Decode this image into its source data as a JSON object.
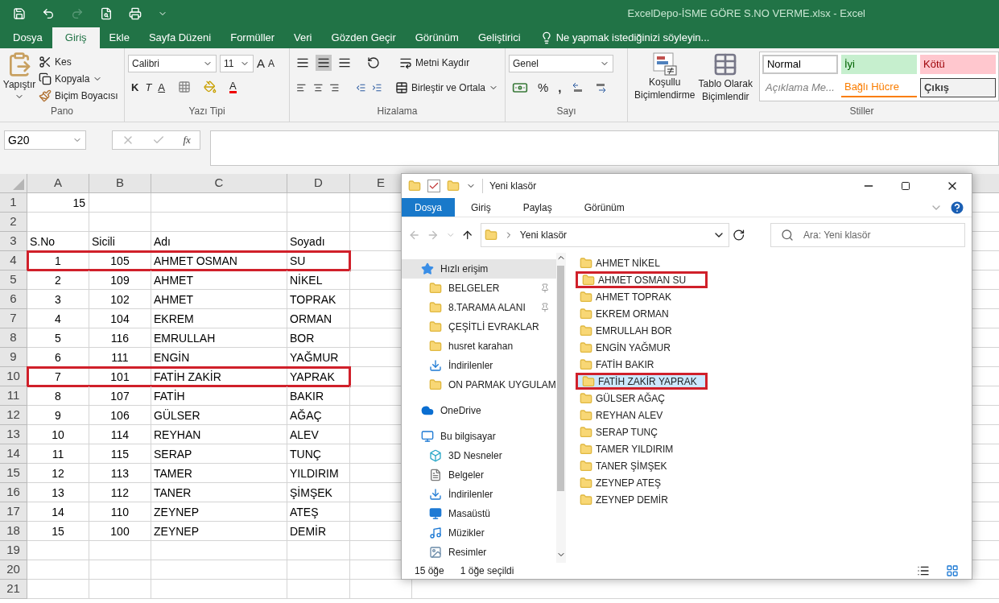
{
  "excel": {
    "title": "ExcelDepo-İSME GÖRE S.NO VERME.xlsx - Excel",
    "tabs": [
      {
        "label": "Dosya",
        "selected": false
      },
      {
        "label": "Giriş",
        "selected": true
      },
      {
        "label": "Ekle",
        "selected": false
      },
      {
        "label": "Sayfa Düzeni",
        "selected": false
      },
      {
        "label": "Formüller",
        "selected": false
      },
      {
        "label": "Veri",
        "selected": false
      },
      {
        "label": "Gözden Geçir",
        "selected": false
      },
      {
        "label": "Görünüm",
        "selected": false
      },
      {
        "label": "Geliştirici",
        "selected": false
      }
    ],
    "tell_me": "Ne yapmak istediğinizi söyleyin...",
    "ribbon": {
      "clipboard": {
        "label": "Pano",
        "paste": "Yapıştır",
        "cut": "Kes",
        "copy": "Kopyala",
        "painter": "Biçim Boyacısı"
      },
      "font": {
        "label": "Yazı Tipi",
        "name": "Calibri",
        "size": "11",
        "grow": "A",
        "shrink": "A",
        "bold": "K",
        "italic": "T",
        "underline": "A",
        "text_color_button": "A"
      },
      "alignment": {
        "label": "Hizalama",
        "wrap": "Metni Kaydır",
        "merge": "Birleştir ve Ortala"
      },
      "number": {
        "label": "Sayı",
        "format": "Genel",
        "percent": "%",
        "comma": ","
      },
      "conditional": "Koşullu Biçimlendirme",
      "table": "Tablo Olarak Biçimlendir",
      "styles": {
        "label": "Stiller",
        "cells": [
          {
            "label": "Normal",
            "kind": "normal"
          },
          {
            "label": "İyi",
            "kind": "good"
          },
          {
            "label": "Kötü",
            "kind": "bad"
          },
          {
            "label": "Açıklama Me...",
            "kind": "note"
          },
          {
            "label": "Bağlı Hücre",
            "kind": "linked"
          },
          {
            "label": "Çıkış",
            "kind": "output"
          }
        ]
      }
    },
    "name_box": "G20",
    "function_label": "fx",
    "columns": [
      "A",
      "B",
      "C",
      "D",
      "E"
    ],
    "rows": [
      {
        "number": "1",
        "cells": [
          "15",
          "",
          "",
          ""
        ],
        "highlighted": false,
        "kind": "top"
      },
      {
        "number": "2",
        "cells": [
          "",
          "",
          "",
          ""
        ],
        "highlighted": false,
        "kind": "data"
      },
      {
        "number": "3",
        "cells": [
          "S.No",
          "Sicili",
          "Adı",
          "Soyadı"
        ],
        "highlighted": false,
        "kind": "header"
      },
      {
        "number": "4",
        "cells": [
          "1",
          "105",
          "AHMET OSMAN",
          "SU"
        ],
        "highlighted": true,
        "kind": "data"
      },
      {
        "number": "5",
        "cells": [
          "2",
          "109",
          "AHMET",
          "NİKEL"
        ],
        "highlighted": false,
        "kind": "data"
      },
      {
        "number": "6",
        "cells": [
          "3",
          "102",
          "AHMET",
          "TOPRAK"
        ],
        "highlighted": false,
        "kind": "data"
      },
      {
        "number": "7",
        "cells": [
          "4",
          "104",
          "EKREM",
          "ORMAN"
        ],
        "highlighted": false,
        "kind": "data"
      },
      {
        "number": "8",
        "cells": [
          "5",
          "116",
          "EMRULLAH",
          "BOR"
        ],
        "highlighted": false,
        "kind": "data"
      },
      {
        "number": "9",
        "cells": [
          "6",
          "111",
          "ENGİN",
          "YAĞMUR"
        ],
        "highlighted": false,
        "kind": "data"
      },
      {
        "number": "10",
        "cells": [
          "7",
          "101",
          "FATİH ZAKİR",
          "YAPRAK"
        ],
        "highlighted": true,
        "kind": "data"
      },
      {
        "number": "11",
        "cells": [
          "8",
          "107",
          "FATİH",
          "BAKIR"
        ],
        "highlighted": false,
        "kind": "data"
      },
      {
        "number": "12",
        "cells": [
          "9",
          "106",
          "GÜLSER",
          "AĞAÇ"
        ],
        "highlighted": false,
        "kind": "data"
      },
      {
        "number": "13",
        "cells": [
          "10",
          "114",
          "REYHAN",
          "ALEV"
        ],
        "highlighted": false,
        "kind": "data"
      },
      {
        "number": "14",
        "cells": [
          "11",
          "115",
          "SERAP",
          "TUNÇ"
        ],
        "highlighted": false,
        "kind": "data"
      },
      {
        "number": "15",
        "cells": [
          "12",
          "113",
          "TAMER",
          "YILDIRIM"
        ],
        "highlighted": false,
        "kind": "data"
      },
      {
        "number": "16",
        "cells": [
          "13",
          "112",
          "TANER",
          "ŞİMŞEK"
        ],
        "highlighted": false,
        "kind": "data"
      },
      {
        "number": "17",
        "cells": [
          "14",
          "110",
          "ZEYNEP",
          "ATEŞ"
        ],
        "highlighted": false,
        "kind": "data"
      },
      {
        "number": "18",
        "cells": [
          "15",
          "100",
          "ZEYNEP",
          "DEMİR"
        ],
        "highlighted": false,
        "kind": "data"
      },
      {
        "number": "19",
        "cells": [
          "",
          "",
          "",
          ""
        ],
        "highlighted": false,
        "kind": "data"
      },
      {
        "number": "20",
        "cells": [
          "",
          "",
          "",
          ""
        ],
        "highlighted": false,
        "kind": "data"
      },
      {
        "number": "21",
        "cells": [
          "",
          "",
          "",
          ""
        ],
        "highlighted": false,
        "kind": "data"
      }
    ]
  },
  "explorer": {
    "title": "Yeni klasör",
    "tabs": [
      {
        "label": "Dosya",
        "selected": true
      },
      {
        "label": "Giriş",
        "selected": false
      },
      {
        "label": "Paylaş",
        "selected": false
      },
      {
        "label": "Görünüm",
        "selected": false
      }
    ],
    "address": "Yeni klasör",
    "search_placeholder": "Ara: Yeni klasör",
    "nav": [
      {
        "label": "Hızlı erişim",
        "kind": "star",
        "selected": true,
        "children": [
          {
            "label": "BELGELER",
            "kind": "folder",
            "pinned": true,
            "selected": false
          },
          {
            "label": "8.TARAMA ALANI",
            "kind": "folder",
            "pinned": true,
            "selected": false
          },
          {
            "label": "ÇEŞİTLİ EVRAKLAR",
            "kind": "folder",
            "pinned": false,
            "selected": false
          },
          {
            "label": "husret karahan",
            "kind": "folder",
            "pinned": false,
            "selected": false
          },
          {
            "label": "İndirilenler",
            "kind": "download",
            "pinned": false,
            "selected": false
          },
          {
            "label": "ON PARMAK UYGULAM",
            "kind": "folder",
            "pinned": false,
            "selected": false
          }
        ]
      },
      {
        "label": "OneDrive",
        "kind": "cloud",
        "selected": false
      },
      {
        "label": "Bu bilgisayar",
        "kind": "pc",
        "selected": false,
        "children": [
          {
            "label": "3D Nesneler",
            "kind": "cube",
            "selected": false
          },
          {
            "label": "Belgeler",
            "kind": "doc",
            "selected": false
          },
          {
            "label": "İndirilenler",
            "kind": "download",
            "selected": false
          },
          {
            "label": "Masaüstü",
            "kind": "desktop",
            "selected": false
          },
          {
            "label": "Müzikler",
            "kind": "music",
            "selected": false
          },
          {
            "label": "Resimler",
            "kind": "pictures",
            "selected": false
          }
        ]
      }
    ],
    "items": [
      {
        "label": "AHMET NİKEL",
        "highlighted": false,
        "selected": false
      },
      {
        "label": "AHMET OSMAN SU",
        "highlighted": true,
        "selected": false
      },
      {
        "label": "AHMET TOPRAK",
        "highlighted": false,
        "selected": false
      },
      {
        "label": "EKREM ORMAN",
        "highlighted": false,
        "selected": false
      },
      {
        "label": "EMRULLAH BOR",
        "highlighted": false,
        "selected": false
      },
      {
        "label": "ENGİN YAĞMUR",
        "highlighted": false,
        "selected": false
      },
      {
        "label": "FATİH BAKIR",
        "highlighted": false,
        "selected": false
      },
      {
        "label": "FATİH ZAKİR YAPRAK",
        "highlighted": true,
        "selected": true
      },
      {
        "label": "GÜLSER AĞAÇ",
        "highlighted": false,
        "selected": false
      },
      {
        "label": "REYHAN ALEV",
        "highlighted": false,
        "selected": false
      },
      {
        "label": "SERAP TUNÇ",
        "highlighted": false,
        "selected": false
      },
      {
        "label": "TAMER YILDIRIM",
        "highlighted": false,
        "selected": false
      },
      {
        "label": "TANER ŞİMŞEK",
        "highlighted": false,
        "selected": false
      },
      {
        "label": "ZEYNEP ATEŞ",
        "highlighted": false,
        "selected": false
      },
      {
        "label": "ZEYNEP DEMİR",
        "highlighted": false,
        "selected": false
      }
    ],
    "status": [
      "15 öğe",
      "1 öğe seçildi"
    ]
  }
}
